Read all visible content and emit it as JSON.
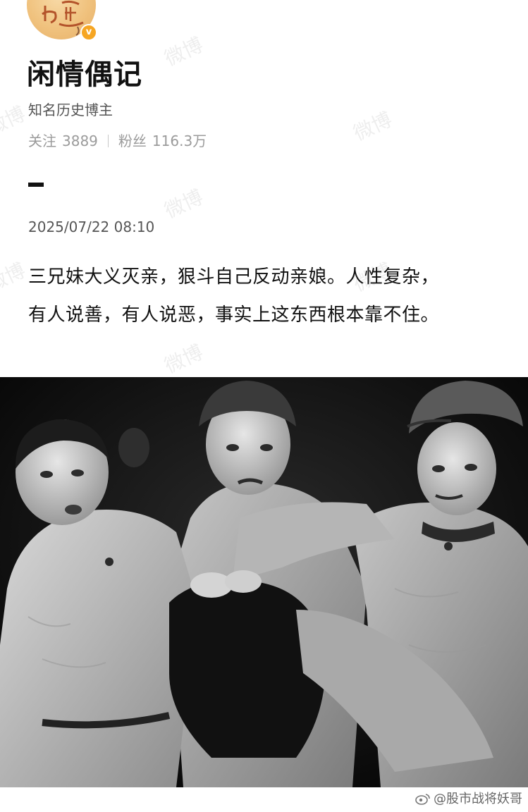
{
  "profile": {
    "display_name": "闲情偶记",
    "bio": "知名历史博主",
    "avatar_text": "上通",
    "verified": true
  },
  "stats": {
    "following_label": "关注",
    "following_count": "3889",
    "followers_label": "粉丝",
    "followers_count": "116.3万"
  },
  "post": {
    "timestamp": "2025/07/22 08:10",
    "lines": [
      "三兄妹大义灭亲，狠斗自己反动亲娘。人性复杂，",
      "有人说善，有人说恶，事实上这东西根本靠不住。"
    ]
  },
  "watermark": "微博",
  "footer": {
    "credit": "@股市战将妖哥"
  },
  "colors": {
    "verified_badge": "#f6a623",
    "avatar_bg": "#f0c27e",
    "muted_text": "#9b9b9b"
  },
  "icons": {
    "verified": "verified-badge-icon",
    "weibo": "weibo-logo-icon"
  }
}
